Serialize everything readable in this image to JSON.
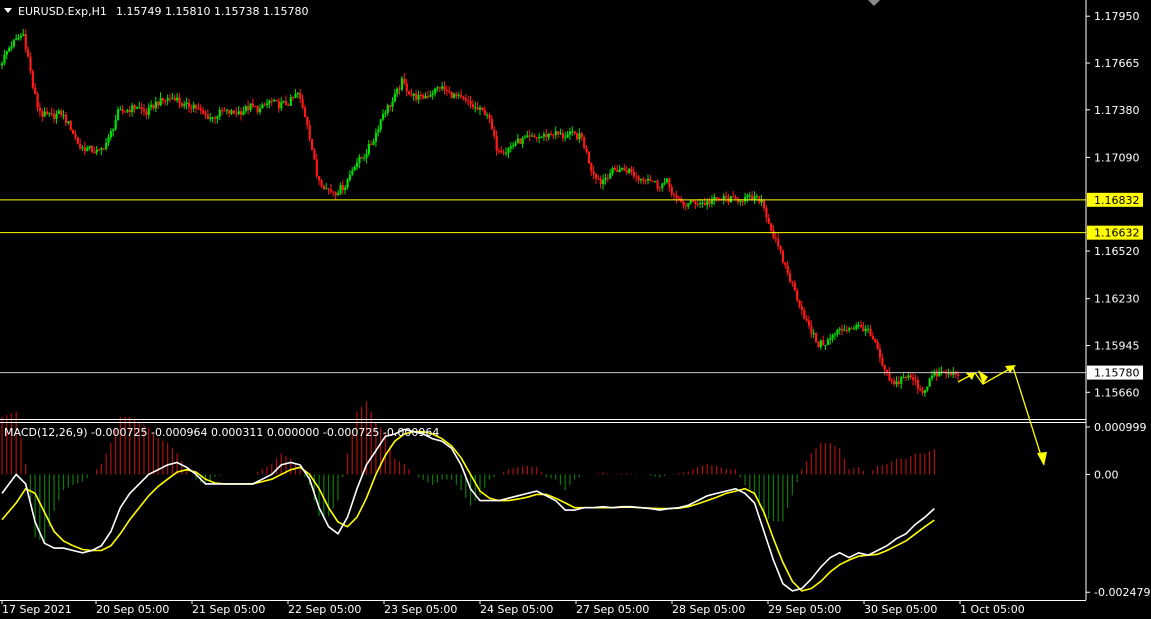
{
  "header": {
    "symbol": "EURUSD.Exp,H1",
    "ohlc": "1.15749 1.15810 1.15738 1.15780"
  },
  "macd_header": "MACD(12,26,9) -0.000725 -0.000964 0.000311 0.000000 -0.000725 -0.000964",
  "colors": {
    "background": "#000000",
    "axis": "#ffffff",
    "bull": "#00e000",
    "bear": "#ff1a1a",
    "level": "#ffff00",
    "bid": "#c8c8c8",
    "macd_line": "#ffffff",
    "signal_line": "#ffff00",
    "hist_pos": "#b01010",
    "hist_neg": "#0e7a0e"
  },
  "chart_data": [
    {
      "type": "candlestick",
      "symbol": "EURUSD.Exp",
      "timeframe": "H1",
      "price_ylim": [
        1.1554,
        1.18
      ],
      "price_ticks": [
        "1.17950",
        "1.17665",
        "1.17380",
        "1.17090",
        "1.16520",
        "1.16230",
        "1.15945",
        "1.15660"
      ],
      "levels": [
        {
          "label": "1.16832",
          "value": 1.16832
        },
        {
          "label": "1.16632",
          "value": 1.16632
        }
      ],
      "bid": {
        "label": "1.15780",
        "value": 1.1578
      },
      "x_labels": [
        "17 Sep 2021",
        "20 Sep 05:00",
        "21 Sep 05:00",
        "22 Sep 05:00",
        "23 Sep 05:00",
        "24 Sep 05:00",
        "27 Sep 05:00",
        "28 Sep 05:00",
        "29 Sep 05:00",
        "30 Sep 05:00",
        "1 Oct 05:00"
      ],
      "path": [
        [
          0,
          1.1765
        ],
        [
          4,
          1.1776
        ],
        [
          8,
          1.1782
        ],
        [
          10,
          1.1784
        ],
        [
          12,
          1.177
        ],
        [
          14,
          1.1752
        ],
        [
          16,
          1.174
        ],
        [
          18,
          1.1735
        ],
        [
          22,
          1.1734
        ],
        [
          26,
          1.1736
        ],
        [
          30,
          1.1727
        ],
        [
          34,
          1.1715
        ],
        [
          38,
          1.1714
        ],
        [
          42,
          1.1712
        ],
        [
          46,
          1.172
        ],
        [
          50,
          1.1736
        ],
        [
          54,
          1.1738
        ],
        [
          58,
          1.174
        ],
        [
          62,
          1.1736
        ],
        [
          66,
          1.1742
        ],
        [
          70,
          1.1744
        ],
        [
          74,
          1.1746
        ],
        [
          78,
          1.174
        ],
        [
          82,
          1.1741
        ],
        [
          86,
          1.1735
        ],
        [
          90,
          1.1733
        ],
        [
          94,
          1.1737
        ],
        [
          98,
          1.1736
        ],
        [
          102,
          1.1737
        ],
        [
          106,
          1.174
        ],
        [
          110,
          1.1738
        ],
        [
          114,
          1.1743
        ],
        [
          118,
          1.1741
        ],
        [
          122,
          1.1742
        ],
        [
          126,
          1.1748
        ],
        [
          130,
          1.173
        ],
        [
          134,
          1.1698
        ],
        [
          138,
          1.169
        ],
        [
          142,
          1.1688
        ],
        [
          146,
          1.1692
        ],
        [
          150,
          1.1705
        ],
        [
          154,
          1.171
        ],
        [
          158,
          1.172
        ],
        [
          162,
          1.1736
        ],
        [
          166,
          1.1743
        ],
        [
          170,
          1.1755
        ],
        [
          174,
          1.1747
        ],
        [
          178,
          1.1745
        ],
        [
          182,
          1.1748
        ],
        [
          186,
          1.1752
        ],
        [
          190,
          1.1748
        ],
        [
          194,
          1.1745
        ],
        [
          198,
          1.1742
        ],
        [
          202,
          1.1738
        ],
        [
          206,
          1.1736
        ],
        [
          210,
          1.1715
        ],
        [
          214,
          1.1713
        ],
        [
          218,
          1.1718
        ],
        [
          222,
          1.172
        ],
        [
          226,
          1.1721
        ],
        [
          230,
          1.1722
        ],
        [
          234,
          1.1724
        ],
        [
          238,
          1.1722
        ],
        [
          242,
          1.1723
        ],
        [
          246,
          1.1721
        ],
        [
          250,
          1.1702
        ],
        [
          254,
          1.1694
        ],
        [
          258,
          1.17
        ],
        [
          262,
          1.1702
        ],
        [
          266,
          1.1701
        ],
        [
          270,
          1.1696
        ],
        [
          274,
          1.1697
        ],
        [
          278,
          1.1692
        ],
        [
          282,
          1.1694
        ],
        [
          286,
          1.1683
        ],
        [
          290,
          1.168
        ],
        [
          294,
          1.1682
        ],
        [
          298,
          1.1681
        ],
        [
          302,
          1.1683
        ],
        [
          306,
          1.1684
        ],
        [
          310,
          1.1683
        ],
        [
          314,
          1.1684
        ],
        [
          318,
          1.1684
        ],
        [
          322,
          1.1683
        ],
        [
          326,
          1.1665
        ],
        [
          330,
          1.165
        ],
        [
          334,
          1.1635
        ],
        [
          338,
          1.162
        ],
        [
          342,
          1.1605
        ],
        [
          346,
          1.1595
        ],
        [
          350,
          1.1597
        ],
        [
          354,
          1.1603
        ],
        [
          358,
          1.1605
        ],
        [
          362,
          1.1606
        ],
        [
          366,
          1.1605
        ],
        [
          370,
          1.1595
        ],
        [
          374,
          1.1578
        ],
        [
          378,
          1.157
        ],
        [
          382,
          1.1576
        ],
        [
          386,
          1.1574
        ],
        [
          390,
          1.1566
        ],
        [
          394,
          1.1576
        ],
        [
          398,
          1.1578
        ],
        [
          402,
          1.1577
        ],
        [
          404,
          1.1578
        ]
      ]
    },
    {
      "type": "histogram_line",
      "title": "MACD(12,26,9)",
      "ylim": [
        -0.0026,
        0.00104
      ],
      "ticks": [
        "0.000999",
        "0.00",
        "-0.002479"
      ],
      "tick_values": [
        0.000999,
        0.0,
        -0.002479
      ],
      "macd_path": [
        [
          0,
          -0.0004
        ],
        [
          6,
          0.0
        ],
        [
          10,
          -0.0002
        ],
        [
          14,
          -0.001
        ],
        [
          18,
          -0.00145
        ],
        [
          22,
          -0.00155
        ],
        [
          26,
          -0.00155
        ],
        [
          30,
          -0.0016
        ],
        [
          34,
          -0.00165
        ],
        [
          38,
          -0.0016
        ],
        [
          42,
          -0.0015
        ],
        [
          46,
          -0.0012
        ],
        [
          50,
          -0.0007
        ],
        [
          54,
          -0.0004
        ],
        [
          58,
          -0.0002
        ],
        [
          62,
          0.0
        ],
        [
          66,
          0.0001
        ],
        [
          70,
          0.0002
        ],
        [
          74,
          0.00025
        ],
        [
          78,
          0.00015
        ],
        [
          82,
          0.0
        ],
        [
          86,
          -0.0002
        ],
        [
          90,
          -0.0002
        ],
        [
          94,
          -0.0002
        ],
        [
          98,
          -0.0002
        ],
        [
          102,
          -0.0002
        ],
        [
          106,
          -0.0002
        ],
        [
          110,
          -0.0001
        ],
        [
          114,
          0.0
        ],
        [
          118,
          0.0002
        ],
        [
          122,
          0.00025
        ],
        [
          126,
          0.0002
        ],
        [
          130,
          -0.0001
        ],
        [
          134,
          -0.0007
        ],
        [
          138,
          -0.0011
        ],
        [
          142,
          -0.00125
        ],
        [
          146,
          -0.0009
        ],
        [
          150,
          -0.0003
        ],
        [
          154,
          0.0002
        ],
        [
          158,
          0.0005
        ],
        [
          162,
          0.0008
        ],
        [
          166,
          0.00085
        ],
        [
          170,
          0.00095
        ],
        [
          174,
          0.0009
        ],
        [
          178,
          0.00085
        ],
        [
          182,
          0.00075
        ],
        [
          186,
          0.0007
        ],
        [
          190,
          0.00055
        ],
        [
          194,
          0.0002
        ],
        [
          198,
          -0.0003
        ],
        [
          202,
          -0.00055
        ],
        [
          206,
          -0.00055
        ],
        [
          210,
          -0.00055
        ],
        [
          214,
          -0.0005
        ],
        [
          218,
          -0.00045
        ],
        [
          222,
          -0.0004
        ],
        [
          226,
          -0.00035
        ],
        [
          230,
          -0.00045
        ],
        [
          234,
          -0.00055
        ],
        [
          238,
          -0.00075
        ],
        [
          242,
          -0.00075
        ],
        [
          246,
          -0.0007
        ],
        [
          250,
          -0.0007
        ],
        [
          254,
          -0.00068
        ],
        [
          258,
          -0.0007
        ],
        [
          262,
          -0.00068
        ],
        [
          266,
          -0.00068
        ],
        [
          270,
          -0.0007
        ],
        [
          274,
          -0.00072
        ],
        [
          278,
          -0.00075
        ],
        [
          282,
          -0.00072
        ],
        [
          286,
          -0.0007
        ],
        [
          290,
          -0.00065
        ],
        [
          294,
          -0.00055
        ],
        [
          298,
          -0.00045
        ],
        [
          302,
          -0.0004
        ],
        [
          306,
          -0.00035
        ],
        [
          310,
          -0.0003
        ],
        [
          314,
          -0.0004
        ],
        [
          318,
          -0.0006
        ],
        [
          322,
          -0.0012
        ],
        [
          326,
          -0.0018
        ],
        [
          330,
          -0.0023
        ],
        [
          334,
          -0.00245
        ],
        [
          338,
          -0.0024
        ],
        [
          342,
          -0.0022
        ],
        [
          346,
          -0.00195
        ],
        [
          350,
          -0.00175
        ],
        [
          354,
          -0.00165
        ],
        [
          358,
          -0.00175
        ],
        [
          362,
          -0.00165
        ],
        [
          366,
          -0.0017
        ],
        [
          370,
          -0.0016
        ],
        [
          374,
          -0.0015
        ],
        [
          378,
          -0.00135
        ],
        [
          382,
          -0.00125
        ],
        [
          386,
          -0.00105
        ],
        [
          390,
          -0.0009
        ],
        [
          394,
          -0.00072
        ]
      ],
      "signal_path": [
        [
          0,
          -0.00095
        ],
        [
          6,
          -0.0006
        ],
        [
          10,
          -0.0003
        ],
        [
          14,
          -0.0004
        ],
        [
          18,
          -0.0008
        ],
        [
          22,
          -0.0012
        ],
        [
          26,
          -0.0014
        ],
        [
          30,
          -0.0015
        ],
        [
          34,
          -0.00158
        ],
        [
          38,
          -0.0016
        ],
        [
          42,
          -0.0016
        ],
        [
          46,
          -0.0015
        ],
        [
          50,
          -0.00125
        ],
        [
          54,
          -0.00095
        ],
        [
          58,
          -0.0007
        ],
        [
          62,
          -0.00045
        ],
        [
          66,
          -0.00025
        ],
        [
          70,
          -0.0001
        ],
        [
          74,
          5e-05
        ],
        [
          78,
          0.0001
        ],
        [
          82,
          5e-05
        ],
        [
          86,
          -0.0001
        ],
        [
          90,
          -0.00018
        ],
        [
          94,
          -0.0002
        ],
        [
          98,
          -0.0002
        ],
        [
          102,
          -0.0002
        ],
        [
          106,
          -0.0002
        ],
        [
          110,
          -0.00015
        ],
        [
          114,
          -0.0001
        ],
        [
          118,
          0.0
        ],
        [
          122,
          0.0001
        ],
        [
          126,
          0.00015
        ],
        [
          130,
          0.0
        ],
        [
          134,
          -0.0003
        ],
        [
          138,
          -0.0007
        ],
        [
          142,
          -0.001
        ],
        [
          146,
          -0.0011
        ],
        [
          150,
          -0.0009
        ],
        [
          154,
          -0.0005
        ],
        [
          158,
          0.0
        ],
        [
          162,
          0.0004
        ],
        [
          166,
          0.0007
        ],
        [
          170,
          0.00085
        ],
        [
          174,
          0.0009
        ],
        [
          178,
          0.0009
        ],
        [
          182,
          0.00085
        ],
        [
          186,
          0.00075
        ],
        [
          190,
          0.0006
        ],
        [
          194,
          0.00035
        ],
        [
          198,
          0.0
        ],
        [
          202,
          -0.00035
        ],
        [
          206,
          -0.0005
        ],
        [
          210,
          -0.00055
        ],
        [
          214,
          -0.00055
        ],
        [
          218,
          -0.00052
        ],
        [
          222,
          -0.00048
        ],
        [
          226,
          -0.00042
        ],
        [
          230,
          -0.00042
        ],
        [
          234,
          -0.0005
        ],
        [
          238,
          -0.0006
        ],
        [
          242,
          -0.0007
        ],
        [
          246,
          -0.0007
        ],
        [
          250,
          -0.0007
        ],
        [
          254,
          -0.0007
        ],
        [
          258,
          -0.0007
        ],
        [
          262,
          -0.00069
        ],
        [
          266,
          -0.00069
        ],
        [
          270,
          -0.0007
        ],
        [
          274,
          -0.00071
        ],
        [
          278,
          -0.00072
        ],
        [
          282,
          -0.00072
        ],
        [
          286,
          -0.00071
        ],
        [
          290,
          -0.00068
        ],
        [
          294,
          -0.00062
        ],
        [
          298,
          -0.00055
        ],
        [
          302,
          -0.00048
        ],
        [
          306,
          -0.0004
        ],
        [
          310,
          -0.00035
        ],
        [
          314,
          -0.0003
        ],
        [
          318,
          -0.0004
        ],
        [
          322,
          -0.0008
        ],
        [
          326,
          -0.00135
        ],
        [
          330,
          -0.00185
        ],
        [
          334,
          -0.00225
        ],
        [
          338,
          -0.00245
        ],
        [
          342,
          -0.0024
        ],
        [
          346,
          -0.00225
        ],
        [
          350,
          -0.00205
        ],
        [
          354,
          -0.0019
        ],
        [
          358,
          -0.0018
        ],
        [
          362,
          -0.00172
        ],
        [
          366,
          -0.0017
        ],
        [
          370,
          -0.00168
        ],
        [
          374,
          -0.0016
        ],
        [
          378,
          -0.0015
        ],
        [
          382,
          -0.0014
        ],
        [
          386,
          -0.00125
        ],
        [
          390,
          -0.0011
        ],
        [
          394,
          -0.00096
        ]
      ]
    }
  ]
}
